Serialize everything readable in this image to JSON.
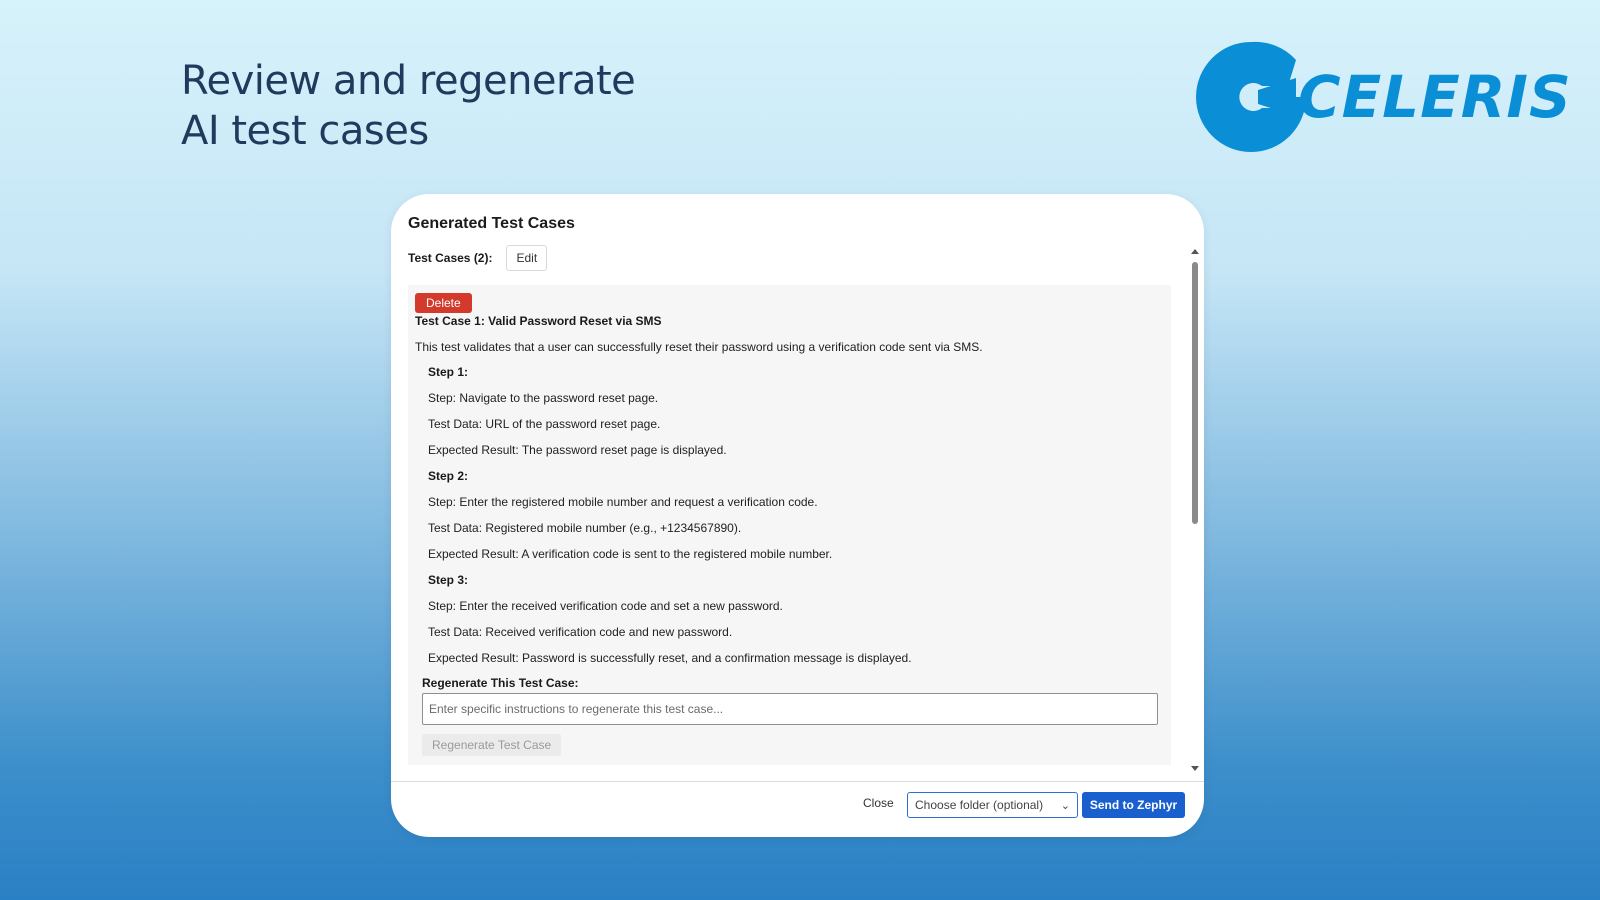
{
  "headline": {
    "line1": "Review and regenerate",
    "line2": "AI test cases"
  },
  "logo": {
    "text": "CELERIS",
    "icon": "celeris-logo-icon",
    "color": "#0a8fd6"
  },
  "dialog": {
    "title": "Generated Test Cases",
    "test_cases_label": "Test Cases (2):",
    "edit_label": "Edit",
    "test_case": {
      "delete_label": "Delete",
      "title": "Test Case 1: Valid Password Reset via SMS",
      "description": "This test validates that a user can successfully reset their password using a verification code sent via SMS.",
      "steps": [
        {
          "heading": "Step 1:",
          "step": "Step: Navigate to the password reset page.",
          "test_data": "Test Data: URL of the password reset page.",
          "expected": "Expected Result: The password reset page is displayed."
        },
        {
          "heading": "Step 2:",
          "step": "Step: Enter the registered mobile number and request a verification code.",
          "test_data": "Test Data: Registered mobile number (e.g., +1234567890).",
          "expected": "Expected Result: A verification code is sent to the registered mobile number."
        },
        {
          "heading": "Step 3:",
          "step": "Step: Enter the received verification code and set a new password.",
          "test_data": "Test Data: Received verification code and new password.",
          "expected": "Expected Result: Password is successfully reset, and a confirmation message is displayed."
        }
      ],
      "regen_label": "Regenerate This Test Case:",
      "regen_placeholder": "Enter specific instructions to regenerate this test case...",
      "regen_button": "Regenerate Test Case"
    },
    "footer": {
      "close_label": "Close",
      "folder_placeholder": "Choose folder (optional)",
      "send_label": "Send to Zephyr"
    }
  },
  "colors": {
    "delete": "#d33a2c",
    "primary": "#1a5fce",
    "headline": "#1f3a5c"
  }
}
